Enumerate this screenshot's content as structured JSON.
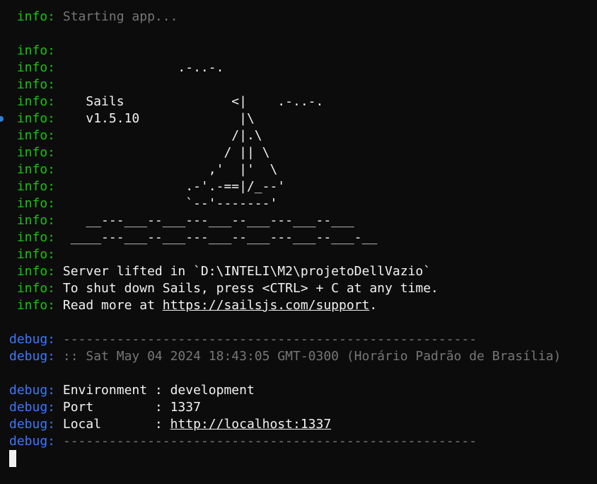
{
  "colors": {
    "background": "#0c0c0c",
    "info_prefix": "#16c60c",
    "debug_prefix": "#3b78ff",
    "text": "#cccccc",
    "dim_text": "#767676",
    "cursor": "#f2f2f2"
  },
  "lines": [
    {
      "prefix": " info:",
      "type": "info",
      "text": " Starting app...",
      "style": "gray"
    },
    {
      "prefix": "",
      "type": "blank",
      "text": ""
    },
    {
      "prefix": " info:",
      "type": "info",
      "text": ""
    },
    {
      "prefix": " info:",
      "type": "info",
      "text": "                .-..-.",
      "style": "white"
    },
    {
      "prefix": " info:",
      "type": "info",
      "text": ""
    },
    {
      "prefix": " info:",
      "type": "info",
      "text": "    Sails              <|    .-..-.",
      "style": "white"
    },
    {
      "prefix": " info:",
      "type": "info",
      "text": "    v1.5.10             |\\",
      "style": "white",
      "marker": true
    },
    {
      "prefix": " info:",
      "type": "info",
      "text": "                       /|.\\",
      "style": "white"
    },
    {
      "prefix": " info:",
      "type": "info",
      "text": "                      / || \\",
      "style": "white"
    },
    {
      "prefix": " info:",
      "type": "info",
      "text": "                    ,'  |'  \\",
      "style": "white"
    },
    {
      "prefix": " info:",
      "type": "info",
      "text": "                 .-'.-==|/_--'",
      "style": "white"
    },
    {
      "prefix": " info:",
      "type": "info",
      "text": "                 `--'-------'",
      "style": "white"
    },
    {
      "prefix": " info:",
      "type": "info",
      "text": "    __---___--___---___--___---___--___",
      "style": "white"
    },
    {
      "prefix": " info:",
      "type": "info",
      "text": "  ____---___--___---___--___---___--___-__",
      "style": "white"
    },
    {
      "prefix": " info:",
      "type": "info",
      "text": ""
    },
    {
      "prefix": " info:",
      "type": "info",
      "text": " Server lifted in `D:\\INTELI\\M2\\projetoDellVazio`",
      "style": "white"
    },
    {
      "prefix": " info:",
      "type": "info",
      "text": " To shut down Sails, press <CTRL> + C at any time.",
      "style": "white"
    },
    {
      "prefix": " info:",
      "type": "info",
      "text": " Read more at ",
      "style": "white",
      "link": "https://sailsjs.com/support",
      "after": "."
    },
    {
      "prefix": "",
      "type": "blank",
      "text": ""
    },
    {
      "prefix": "debug:",
      "type": "debug",
      "text": " ------------------------------------------------------",
      "style": "gray"
    },
    {
      "prefix": "debug:",
      "type": "debug",
      "text": " :: Sat May 04 2024 18:43:05 GMT-0300 (Horário Padrão de Brasília)",
      "style": "gray"
    },
    {
      "prefix": "",
      "type": "blank",
      "text": ""
    },
    {
      "prefix": "debug:",
      "type": "debug",
      "text": " Environment : development",
      "style": "white"
    },
    {
      "prefix": "debug:",
      "type": "debug",
      "text": " Port        : 1337",
      "style": "white"
    },
    {
      "prefix": "debug:",
      "type": "debug",
      "text": " Local       : ",
      "style": "white",
      "link": "http://localhost:1337"
    },
    {
      "prefix": "debug:",
      "type": "debug",
      "text": " ------------------------------------------------------",
      "style": "gray"
    }
  ]
}
